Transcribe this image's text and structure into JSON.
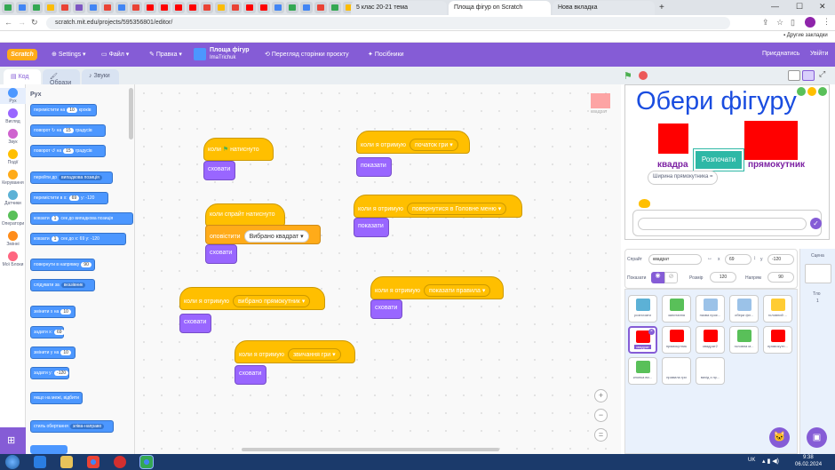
{
  "browser": {
    "tabs": [
      "5 клас 20-21 тема",
      "Площа фігур on Scratch",
      "Нова вкладка"
    ],
    "url": "scratch.mit.edu/projects/595356801/editor/",
    "bookmarks_label": "Другие закладки"
  },
  "menu": {
    "settings": "Settings",
    "file": "Файл",
    "edit": "Правка",
    "project_title": "Площа фігур",
    "author": "ImaTrichuk",
    "see_project": "Перегляд сторінки проєкту",
    "tutorials": "Посібники",
    "share": "Приєднатись",
    "signin": "Увійти"
  },
  "editor_tabs": [
    "Код",
    "Образи",
    "Звуки"
  ],
  "categories": [
    {
      "label": "Рух",
      "color": "#4c97ff"
    },
    {
      "label": "Вигляд",
      "color": "#9966ff"
    },
    {
      "label": "Звук",
      "color": "#cf63cf"
    },
    {
      "label": "Події",
      "color": "#ffbf00"
    },
    {
      "label": "Керування",
      "color": "#ffab19"
    },
    {
      "label": "Датчики",
      "color": "#5cb1d6"
    },
    {
      "label": "Оператори",
      "color": "#59c059"
    },
    {
      "label": "Змінні",
      "color": "#ff8c1a"
    },
    {
      "label": "Мої Блоки",
      "color": "#ff6680"
    }
  ],
  "palette": {
    "heading": "Рух",
    "blocks": [
      {
        "t": "перемістити на",
        "n": "10",
        "s": "кроків"
      },
      {
        "t": "поворот ↻ на",
        "n": "15",
        "s": "градусів"
      },
      {
        "t": "поворот ↺ на",
        "n": "15",
        "s": "градусів"
      },
      {
        "t": "перейти до",
        "d": "випадкова позиція"
      },
      {
        "t": "перемістити в x:",
        "n": "69",
        "s": "y: -120"
      },
      {
        "t": "ковзати",
        "n": "1",
        "s": "сек до випадкова позиція"
      },
      {
        "t": "ковзати",
        "n": "1",
        "s": "сек до x: 69 y: -120"
      },
      {
        "t": "повернути в напрямку",
        "n": "90",
        "s": ""
      },
      {
        "t": "слідувати за",
        "d": "вказівник"
      },
      {
        "t": "змінити x на",
        "n": "10",
        "s": ""
      },
      {
        "t": "задати x:",
        "n": "69",
        "s": ""
      },
      {
        "t": "змінити y на",
        "n": "10",
        "s": ""
      },
      {
        "t": "задати y:",
        "n": "-120",
        "s": ""
      },
      {
        "t": "якщо на межі, відбити",
        "n": "",
        "s": ""
      },
      {
        "t": "стиль обертання",
        "d": "зліва-направо"
      }
    ]
  },
  "scripts": {
    "s1_hat": "коли",
    "s1_hat2": "натиснуто",
    "s1_cmd": "сховати",
    "s2_hat": "коли спрайт натиснуто",
    "s2_ev": "оповістити",
    "s2_dd": "Вибрано квадрат",
    "s2_cmd": "сховати",
    "s3_hat": "коли я отримую",
    "s3_dd": "вибрано прямокутник",
    "s3_cmd": "сховати",
    "s4_hat": "коли я отримую",
    "s4_dd": "звичання гри",
    "s4_cmd": "сховати",
    "s5_hat": "коли я отримую",
    "s5_dd": "початок гри",
    "s5_cmd": "показати",
    "s6_hat": "коли я отримую",
    "s6_dd": "повернутися в Головне меню",
    "s6_cmd": "показати",
    "s7_hat": "коли я отримую",
    "s7_dd": "показати правила",
    "s7_cmd": "сховати",
    "sprite_label": "квадрат"
  },
  "stage": {
    "title": "Обери фігуру",
    "btn": "Розпочати",
    "left_label": "квадра",
    "right_label": "прямокутник",
    "ask": "Ширина прямокутника ="
  },
  "sprite_info": {
    "sprite_label": "Спрайт",
    "sprite_name": "квадрат",
    "x_label": "x",
    "x": "69",
    "y_label": "y",
    "y": "-120",
    "show_label": "Показати",
    "size_label": "Розмір",
    "size": "120",
    "dir_label": "Напрям",
    "dir": "90"
  },
  "sprites": [
    {
      "name": "розпочати",
      "color": "#5cb1d6"
    },
    {
      "name": "запитання",
      "color": "#59c059"
    },
    {
      "name": "назва проє...",
      "color": "#9bc2e8"
    },
    {
      "name": "обери фіг...",
      "color": "#9bc2e8"
    },
    {
      "name": "головний ...",
      "color": "#ffcc33"
    },
    {
      "name": "квадрат",
      "color": "#ff0000"
    },
    {
      "name": "прямокутник",
      "color": "#ff0000"
    },
    {
      "name": "квадрат2",
      "color": "#ff0000"
    },
    {
      "name": "головна м...",
      "color": "#59c059"
    },
    {
      "name": "прямокутн...",
      "color": "#ff0000"
    },
    {
      "name": "кнопка ви...",
      "color": "#59c059"
    },
    {
      "name": "правила гри",
      "color": "#ffffff"
    },
    {
      "name": "вихід з пр...",
      "color": "#ffffff"
    }
  ],
  "scene": {
    "label": "Сцена",
    "backdrops_label": "Тло",
    "backdrops_count": "1"
  },
  "taskbar": {
    "lang": "UK",
    "time": "9:38",
    "date": "06.02.2024"
  }
}
